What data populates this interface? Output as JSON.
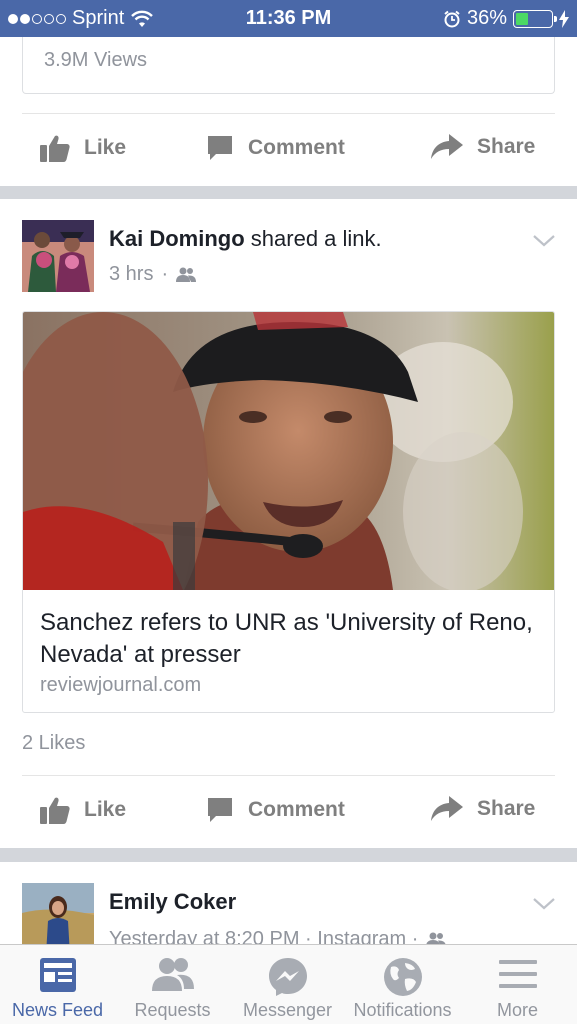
{
  "status_bar": {
    "carrier": "Sprint",
    "time": "11:36 PM",
    "battery": "36%",
    "battery_level": 0.36,
    "signal_bars_filled": 2,
    "signal_bars_total": 5
  },
  "prev_post": {
    "views": "3.9M Views"
  },
  "actions": {
    "like": "Like",
    "comment": "Comment",
    "share": "Share"
  },
  "post1": {
    "author": "Kai Domingo",
    "action": " shared a link.",
    "time": "3 hrs",
    "separator": "·",
    "link_title": "Sanchez refers to UNR as 'University of Reno, Nevada' at presser",
    "link_domain": "reviewjournal.com",
    "likes": "2 Likes"
  },
  "post2": {
    "author": "Emily Coker",
    "meta": "Yesterday at 8:20 PM · Instagram ·"
  },
  "tabs": [
    {
      "label": "News Feed",
      "icon": "news-feed-icon"
    },
    {
      "label": "Requests",
      "icon": "friend-requests-icon"
    },
    {
      "label": "Messenger",
      "icon": "messenger-icon"
    },
    {
      "label": "Notifications",
      "icon": "globe-icon"
    },
    {
      "label": "More",
      "icon": "menu-icon"
    }
  ],
  "colors": {
    "brand": "#4a68a8",
    "battery": "#4cd964",
    "separator": "#d3d6db"
  }
}
